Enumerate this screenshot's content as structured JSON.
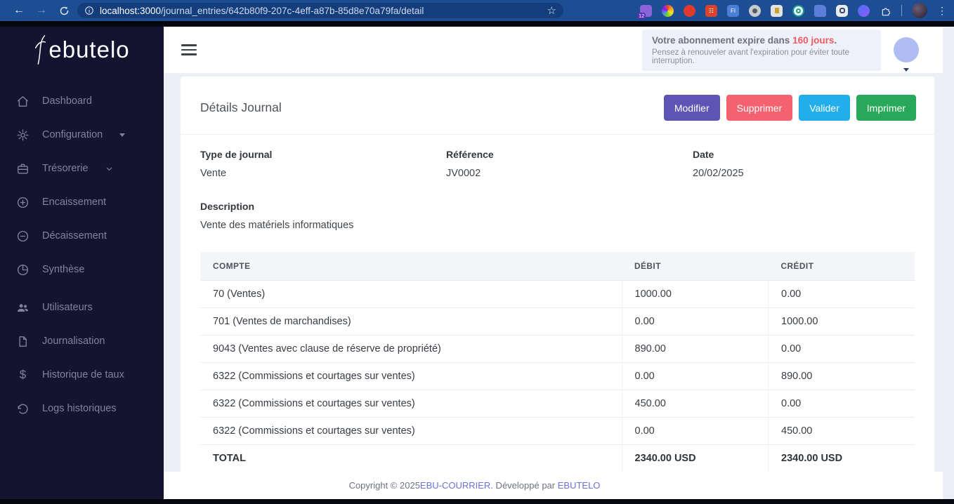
{
  "browser": {
    "url_host": "localhost:3000",
    "url_path": "/journal_entries/642b80f9-207c-4eff-a87b-85d8e70a79fa/detail",
    "extensions_badge": "12",
    "ext_fi_label": "FI"
  },
  "sidebar": {
    "logo": "ebutelo",
    "items": [
      {
        "label": "Dashboard",
        "icon": "home",
        "caret": "none"
      },
      {
        "label": "Configuration",
        "icon": "gear",
        "caret": "solid"
      },
      {
        "label": "Trésorerie",
        "icon": "briefcase",
        "caret": "chevron"
      },
      {
        "label": "Encaissement",
        "icon": "plus-circle",
        "caret": "none"
      },
      {
        "label": "Décaissement",
        "icon": "minus-circle",
        "caret": "none"
      },
      {
        "label": "Synthèse",
        "icon": "pie-chart",
        "caret": "none"
      },
      {
        "label": "Utilisateurs",
        "icon": "users",
        "caret": "none",
        "spaced": true
      },
      {
        "label": "Journalisation",
        "icon": "document",
        "caret": "none"
      },
      {
        "label": "Historique de taux",
        "icon": "dollar",
        "caret": "none"
      },
      {
        "label": "Logs historiques",
        "icon": "history",
        "caret": "none"
      }
    ]
  },
  "header": {
    "notification": {
      "line1_prefix": "Votre abonnement expire dans ",
      "line1_highlight": "160 jours",
      "line1_suffix": ".",
      "line2": "Pensez à renouveler avant l'expiration pour éviter toute interruption."
    }
  },
  "page": {
    "title": "Détails Journal",
    "buttons": {
      "modify": {
        "label": "Modifier",
        "color": "#5d55b5"
      },
      "delete": {
        "label": "Supprimer",
        "color": "#f4616f"
      },
      "validate": {
        "label": "Valider",
        "color": "#22aeeb"
      },
      "print": {
        "label": "Imprimer",
        "color": "#2aa85a"
      }
    },
    "fields": [
      {
        "label": "Type de journal",
        "value": "Vente"
      },
      {
        "label": "Référence",
        "value": "JV0002"
      },
      {
        "label": "Date",
        "value": "20/02/2025"
      }
    ],
    "description": {
      "label": "Description",
      "value": "Vente des matériels informatiques"
    }
  },
  "table": {
    "columns": [
      "COMPTE",
      "DÉBIT",
      "CRÉDIT"
    ],
    "rows": [
      [
        "70 (Ventes)",
        "1000.00",
        "0.00"
      ],
      [
        "701 (Ventes de marchandises)",
        "0.00",
        "1000.00"
      ],
      [
        "9043 (Ventes avec clause de réserve de propriété)",
        "890.00",
        "0.00"
      ],
      [
        "6322 (Commissions et courtages sur ventes)",
        "0.00",
        "890.00"
      ],
      [
        "6322 (Commissions et courtages sur ventes)",
        "450.00",
        "0.00"
      ],
      [
        "6322 (Commissions et courtages sur ventes)",
        "0.00",
        "450.00"
      ]
    ],
    "total": {
      "label": "TOTAL",
      "debit": "2340.00 USD",
      "credit": "2340.00 USD"
    }
  },
  "footer": {
    "prefix": "Copyright © 2025 ",
    "link1": "EBU-COURRIER",
    "middle": ". Développé par ",
    "link2": "EBUTELO"
  }
}
